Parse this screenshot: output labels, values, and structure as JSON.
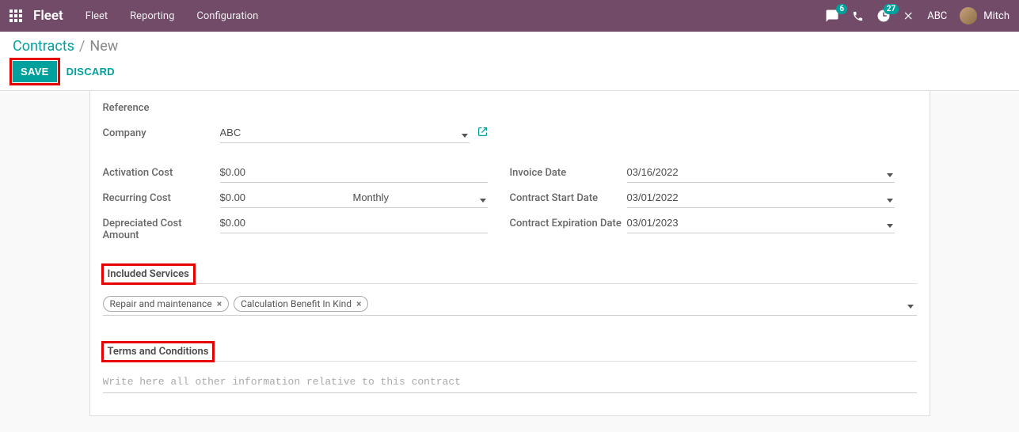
{
  "navbar": {
    "brand": "Fleet",
    "menu": [
      "Fleet",
      "Reporting",
      "Configuration"
    ],
    "messages_count": "6",
    "activities_count": "27",
    "company": "ABC",
    "user": "Mitch"
  },
  "breadcrumb": {
    "root": "Contracts",
    "sep": "/",
    "current": "New"
  },
  "buttons": {
    "save": "SAVE",
    "discard": "DISCARD"
  },
  "fields": {
    "reference": {
      "label": "Reference",
      "value": ""
    },
    "company": {
      "label": "Company",
      "value": "ABC"
    },
    "activation_cost": {
      "label": "Activation Cost",
      "value": "$0.00"
    },
    "recurring_cost": {
      "label": "Recurring Cost",
      "value": "$0.00",
      "frequency": "Monthly"
    },
    "depreciated": {
      "label": "Depreciated Cost Amount",
      "value": "$0.00"
    },
    "invoice_date": {
      "label": "Invoice Date",
      "value": "03/16/2022"
    },
    "start_date": {
      "label": "Contract Start Date",
      "value": "03/01/2022"
    },
    "expiration_date": {
      "label": "Contract Expiration Date",
      "value": "03/01/2023"
    }
  },
  "sections": {
    "included_services": "Included Services",
    "terms": "Terms and Conditions"
  },
  "tags": [
    "Repair and maintenance",
    "Calculation Benefit In Kind"
  ],
  "terms_placeholder": "Write here all other information relative to this contract"
}
